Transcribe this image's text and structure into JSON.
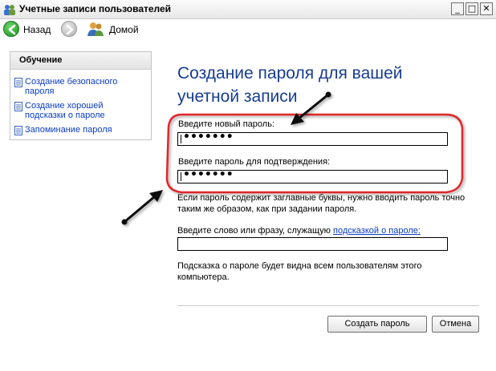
{
  "window": {
    "title": "Учетные записи пользователей",
    "min_glyph": "_",
    "max_glyph": "□",
    "close_glyph": "✕"
  },
  "toolbar": {
    "back_label": "Назад",
    "home_label": "Домой"
  },
  "sidebar": {
    "header": "Обучение",
    "items": [
      {
        "label": "Создание безопасного пароля",
        "icon": "document-icon"
      },
      {
        "label": "Создание хорошей подсказки о пароле",
        "icon": "document-icon"
      },
      {
        "label": "Запоминание пароля",
        "icon": "document-icon"
      }
    ]
  },
  "main": {
    "title": "Создание пароля для вашей учетной записи",
    "new_password_label": "Введите новый пароль:",
    "new_password_value": "•••••••",
    "confirm_password_label": "Введите пароль для подтверждения:",
    "confirm_password_value": "•••••••",
    "case_notice": "Если пароль содержит заглавные буквы, нужно вводить пароль точно таким же образом, как при задании пароля.",
    "hint_label_prefix": "Введите слово или фразу, служащую ",
    "hint_label_link": "подсказкой о пароле:",
    "hint_value": "",
    "hint_notice": "Подсказка о пароле будет видна всем пользователям этого компьютера.",
    "create_button": "Создать пароль",
    "cancel_button": "Отмена"
  },
  "colors": {
    "title_blue": "#173d8f",
    "link_blue": "#0a3cc4",
    "annotation_red": "#e0262b"
  }
}
